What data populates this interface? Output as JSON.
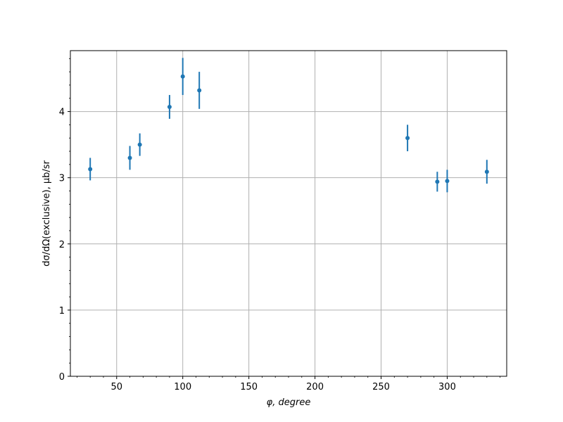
{
  "chart_data": {
    "type": "scatter",
    "title": "",
    "xlabel": "φ, degree",
    "ylabel": "dσ/dΩ(exclusive), μb/sr",
    "xlim": [
      15,
      345
    ],
    "ylim": [
      0,
      4.92
    ],
    "xticks": [
      50,
      100,
      150,
      200,
      250,
      300
    ],
    "yticks": [
      0,
      1,
      2,
      3,
      4
    ],
    "grid": true,
    "legend": "none",
    "series": [
      {
        "color": "#1f77b4",
        "points": [
          {
            "x": 30,
            "y": 3.13,
            "err": 0.17
          },
          {
            "x": 60,
            "y": 3.3,
            "err": 0.18
          },
          {
            "x": 67.5,
            "y": 3.5,
            "err": 0.17
          },
          {
            "x": 90,
            "y": 4.07,
            "err": 0.18
          },
          {
            "x": 100,
            "y": 4.53,
            "err": 0.28
          },
          {
            "x": 112.5,
            "y": 4.32,
            "err": 0.28
          },
          {
            "x": 270,
            "y": 3.6,
            "err": 0.2
          },
          {
            "x": 292.5,
            "y": 2.94,
            "err": 0.15
          },
          {
            "x": 300,
            "y": 2.95,
            "err": 0.17
          },
          {
            "x": 330,
            "y": 3.09,
            "err": 0.18
          }
        ]
      }
    ]
  }
}
